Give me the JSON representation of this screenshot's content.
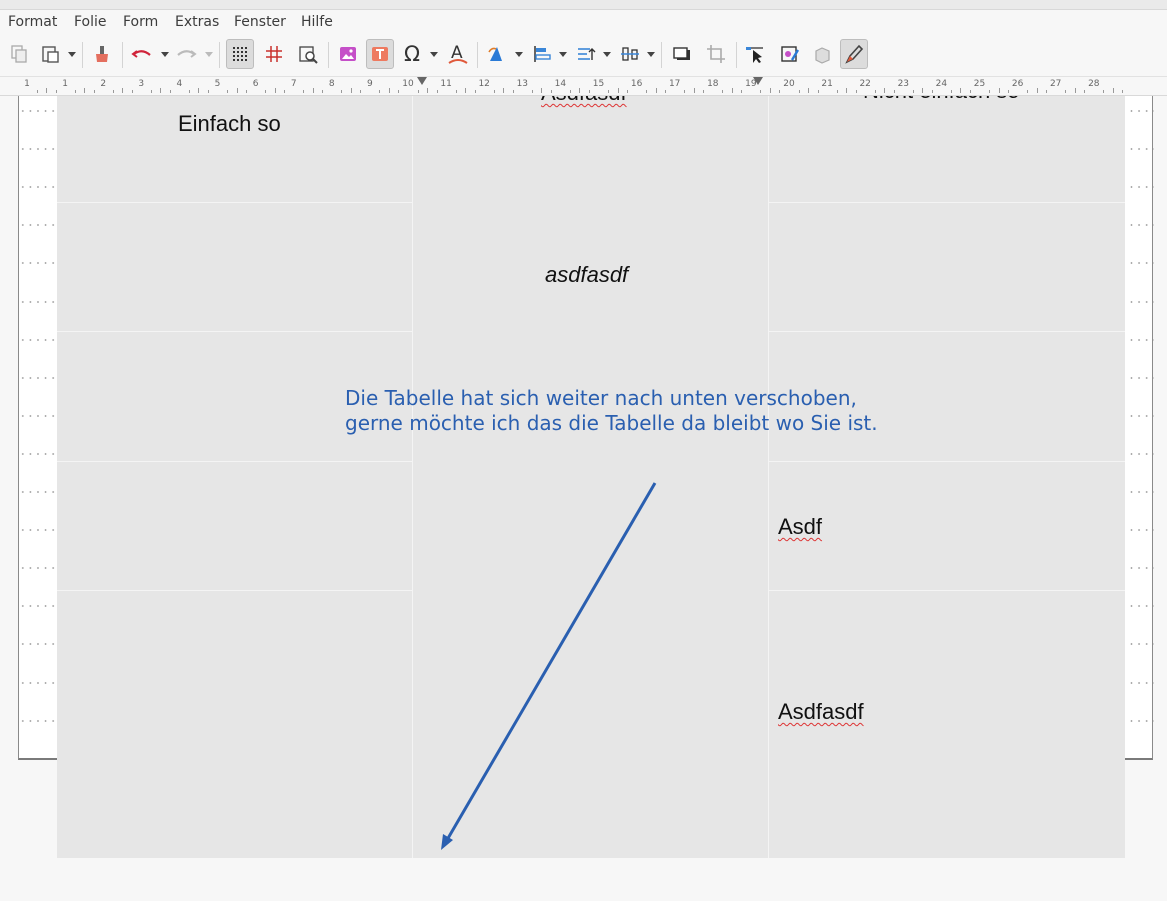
{
  "menu": {
    "items": [
      "Format",
      "Folie",
      "Form",
      "Extras",
      "Fenster",
      "Hilfe"
    ]
  },
  "toolbar": {
    "buttons": [
      {
        "name": "copy-icon",
        "glyph": "⧉"
      },
      {
        "name": "paste-icon",
        "glyph": "📋"
      },
      {
        "name": "clone-formatting-icon",
        "glyph": "🖌"
      },
      {
        "name": "undo-icon",
        "glyph": "↶"
      },
      {
        "name": "redo-icon",
        "glyph": "↷"
      },
      {
        "name": "grid-icon",
        "glyph": "▦"
      },
      {
        "name": "snap-lines-icon",
        "glyph": "#"
      },
      {
        "name": "zoom-pan-icon",
        "glyph": "🔍"
      },
      {
        "name": "insert-image-icon",
        "glyph": "🖼"
      },
      {
        "name": "insert-textbox-icon",
        "glyph": "T"
      },
      {
        "name": "special-character-icon",
        "glyph": "Ω"
      },
      {
        "name": "fontwork-icon",
        "glyph": "A"
      },
      {
        "name": "transformations-icon",
        "glyph": "⟲"
      },
      {
        "name": "align-objects-icon",
        "glyph": "⊫"
      },
      {
        "name": "arrange-icon",
        "glyph": "⇞"
      },
      {
        "name": "distribute-icon",
        "glyph": "⫼"
      },
      {
        "name": "shadow-icon",
        "glyph": "▭"
      },
      {
        "name": "crop-icon",
        "glyph": "⌗"
      },
      {
        "name": "points-icon",
        "glyph": "⇱"
      },
      {
        "name": "toggle-extrusion-icon",
        "glyph": "◈"
      },
      {
        "name": "3d-object-icon",
        "glyph": "▣"
      },
      {
        "name": "show-draw-functions-icon",
        "glyph": "✎"
      }
    ]
  },
  "ruler": {
    "labels": [
      "1",
      "1",
      "2",
      "3",
      "4",
      "5",
      "6",
      "7",
      "8",
      "9",
      "10",
      "11",
      "12",
      "13",
      "14",
      "15",
      "16",
      "17",
      "18",
      "19",
      "20",
      "21",
      "22",
      "23",
      "24",
      "25",
      "26",
      "27",
      "28"
    ]
  },
  "table": {
    "cells": {
      "r1c1": "Einfach so",
      "r1c2_partial": "Asdfasdf",
      "r1c3_partial": "Nicht einfach so",
      "r2c2": "asdfasdf",
      "r4c3": "Asdf",
      "r5c3": "Asdfasdf"
    }
  },
  "annotation": {
    "line1": "Die Tabelle hat sich weiter nach unten verschoben,",
    "line2": "gerne möchte ich das die Tabelle da bleibt wo Sie ist."
  },
  "colors": {
    "annotation": "#2a5fb0",
    "table_fill": "#e6e6e6",
    "spell_underline": "#d33"
  }
}
